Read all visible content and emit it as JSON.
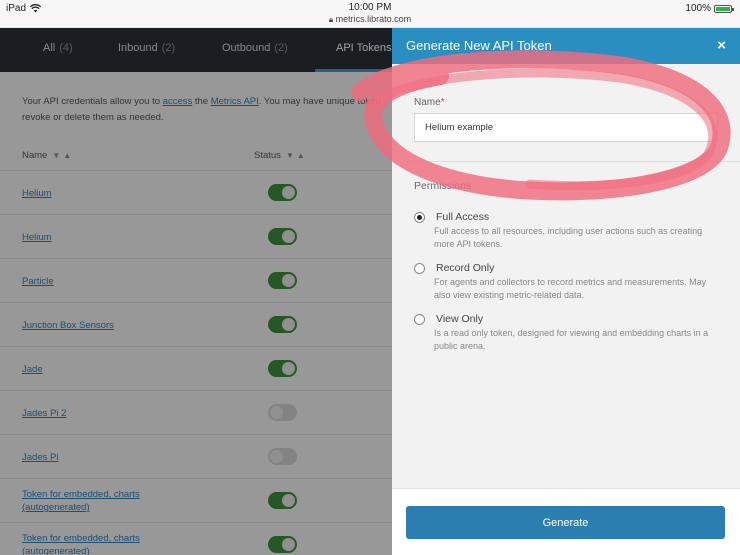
{
  "status_bar": {
    "device": "iPad",
    "time": "10:00 PM",
    "url": "metrics.librato.com",
    "battery": "100%"
  },
  "nav": {
    "tabs": [
      {
        "label": "All",
        "count": "(4)"
      },
      {
        "label": "Inbound",
        "count": "(2)"
      },
      {
        "label": "Outbound",
        "count": "(2)"
      },
      {
        "label": "API Tokens",
        "count": ""
      }
    ]
  },
  "intro": {
    "part1": "Your API credentials allow you to ",
    "link_access": "access",
    "part2": " the ",
    "link_api": "Metrics API",
    "part3": ". You may have unique token",
    "line2": "revoke or delete them as needed."
  },
  "table": {
    "col_name": "Name",
    "col_status": "Status",
    "sort_arrows": "▼▲",
    "rows": [
      {
        "name": "Helium",
        "enabled": true
      },
      {
        "name": "Helium",
        "enabled": true
      },
      {
        "name": "Particle",
        "enabled": true
      },
      {
        "name": "Junction Box Sensors",
        "enabled": true
      },
      {
        "name": "Jade",
        "enabled": true
      },
      {
        "name": "Jades Pi 2",
        "enabled": false
      },
      {
        "name": "Jades Pi",
        "enabled": false
      },
      {
        "name": "Token for embedded, charts (autogenerated)",
        "enabled": true
      },
      {
        "name": "Token for embedded, charts (autogenerated)",
        "enabled": true
      }
    ]
  },
  "drawer": {
    "title": "Generate New API Token",
    "close_icon": "×",
    "name_label": "Name",
    "required_mark": "*",
    "name_value": "Helium example",
    "permissions_label": "Permissions",
    "options": [
      {
        "title": "Full Access",
        "checked": true,
        "description": "Full access to all resources, including user actions such as creating more API tokens."
      },
      {
        "title": "Record Only",
        "checked": false,
        "description": "For agents and collectors to record metrics and measurements. May also view existing metric-related data."
      },
      {
        "title": "View Only",
        "checked": false,
        "description": "Is a read only token, designed for viewing and embedding charts in a public arena."
      }
    ],
    "generate_label": "Generate"
  },
  "colors": {
    "accent": "#2a8fc0",
    "button": "#2a7fb0",
    "toggle_on": "#3e8e3c",
    "nav_bg": "#2b3137",
    "scribble": "#f06b7e"
  }
}
